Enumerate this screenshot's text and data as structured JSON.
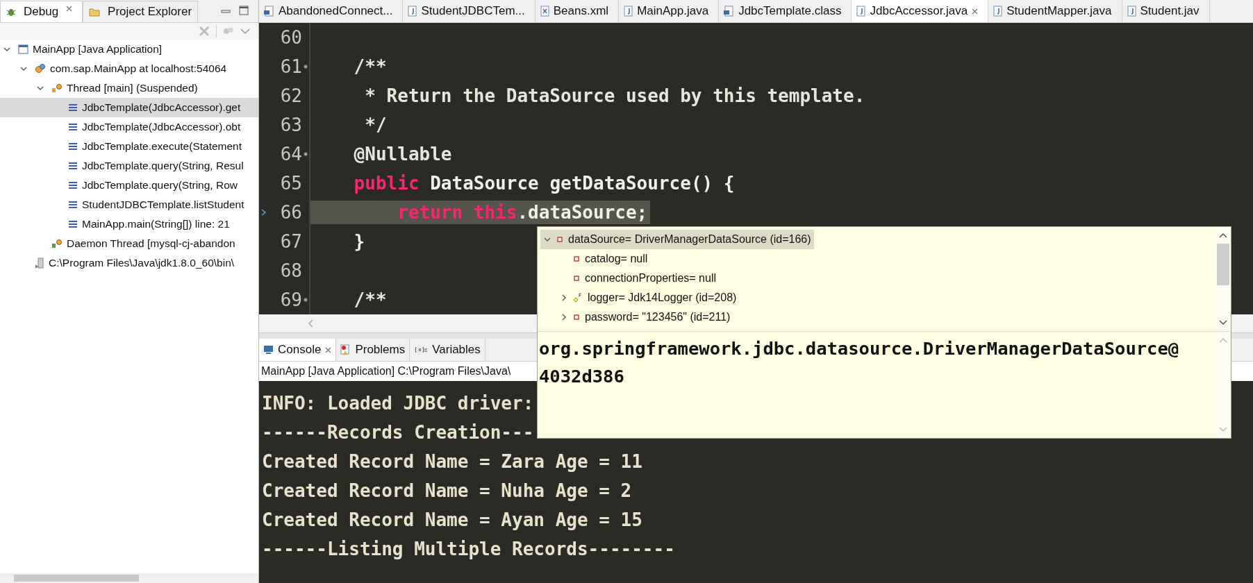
{
  "debug_panel": {
    "tabs": [
      {
        "label": "Debug",
        "selected": true,
        "kind": "bug"
      },
      {
        "label": "Project Explorer",
        "selected": false,
        "kind": "folder"
      }
    ],
    "tree": [
      {
        "label": "MainApp [Java Application]",
        "kind": "launch",
        "expanded": true,
        "selected": false,
        "children": [
          {
            "label": "com.sap.MainApp at localhost:54064",
            "kind": "target",
            "expanded": true,
            "selected": false,
            "children": [
              {
                "label": "Thread [main] (Suspended)",
                "kind": "thread",
                "expanded": true,
                "selected": false,
                "children": [
                  {
                    "label": "JdbcTemplate(JdbcAccessor).get",
                    "kind": "frame",
                    "selected": true
                  },
                  {
                    "label": "JdbcTemplate(JdbcAccessor).obt",
                    "kind": "frame",
                    "selected": false
                  },
                  {
                    "label": "JdbcTemplate.execute(Statement",
                    "kind": "frame",
                    "selected": false
                  },
                  {
                    "label": "JdbcTemplate.query(String, Resul",
                    "kind": "frame",
                    "selected": false
                  },
                  {
                    "label": "JdbcTemplate.query(String, Row",
                    "kind": "frame",
                    "selected": false
                  },
                  {
                    "label": "StudentJDBCTemplate.listStudent",
                    "kind": "frame",
                    "selected": false
                  },
                  {
                    "label": "MainApp.main(String[]) line: 21",
                    "kind": "frame",
                    "selected": false
                  }
                ]
              },
              {
                "label": "Daemon Thread [mysql-cj-abandon",
                "kind": "daemon",
                "selected": false
              }
            ]
          },
          {
            "label": "C:\\Program Files\\Java\\jdk1.8.0_60\\bin\\",
            "kind": "process",
            "selected": false
          }
        ]
      }
    ]
  },
  "editor_tabs": [
    {
      "label": "AbandonedConnect...",
      "kind": "class",
      "selected": false
    },
    {
      "label": "StudentJDBCTem...",
      "kind": "java",
      "selected": false
    },
    {
      "label": "Beans.xml",
      "kind": "xml",
      "selected": false
    },
    {
      "label": "MainApp.java",
      "kind": "java",
      "selected": false
    },
    {
      "label": "JdbcTemplate.class",
      "kind": "class",
      "selected": false
    },
    {
      "label": "JdbcAccessor.java",
      "kind": "java",
      "selected": true
    },
    {
      "label": "StudentMapper.java",
      "kind": "java",
      "selected": false
    },
    {
      "label": "Student.jav",
      "kind": "java",
      "selected": false
    }
  ],
  "editor": {
    "lines": [
      {
        "number": "60",
        "foldable": false,
        "current": false
      },
      {
        "number": "61",
        "foldable": true,
        "current": false,
        "tokens": [
          {
            "text": "    /**",
            "kind": "comment"
          }
        ]
      },
      {
        "number": "62",
        "foldable": false,
        "current": false,
        "tokens": [
          {
            "text": "     * Return the DataSource used by this template.",
            "kind": "comment"
          }
        ]
      },
      {
        "number": "63",
        "foldable": false,
        "current": false,
        "tokens": [
          {
            "text": "     */",
            "kind": "comment"
          }
        ]
      },
      {
        "number": "64",
        "foldable": true,
        "current": false,
        "tokens": [
          {
            "text": "    @Nullable",
            "kind": "annotation"
          }
        ]
      },
      {
        "number": "65",
        "foldable": false,
        "current": false,
        "tokens": [
          {
            "text": "    public",
            "kind": "keyword"
          },
          {
            "text": " DataSource getDataSource() {",
            "kind": "plain"
          }
        ]
      },
      {
        "number": "66",
        "foldable": false,
        "current": true,
        "tokens": [
          {
            "text": "        return",
            "kind": "keyword"
          },
          {
            "text": " this",
            "kind": "keyword"
          },
          {
            "text": ".dataSource;",
            "kind": "plain"
          }
        ]
      },
      {
        "number": "67",
        "foldable": false,
        "current": false,
        "tokens": [
          {
            "text": "    }",
            "kind": "plain"
          }
        ]
      },
      {
        "number": "68",
        "foldable": false,
        "current": false
      },
      {
        "number": "69",
        "foldable": true,
        "current": false,
        "tokens": [
          {
            "text": "    /**",
            "kind": "comment"
          }
        ]
      }
    ]
  },
  "hover": {
    "tree": [
      {
        "label": "dataSource= DriverManagerDataSource  (id=166)",
        "kind": "private",
        "expanded": true,
        "selected": true
      },
      {
        "label": "catalog= null",
        "kind": "private",
        "selected": false
      },
      {
        "label": "connectionProperties= null",
        "kind": "private",
        "selected": false
      },
      {
        "label": "logger= Jdk14Logger  (id=208)",
        "kind": "static",
        "expanded": false,
        "selected": false
      },
      {
        "label": "password= \"123456\" (id=211)",
        "kind": "private",
        "expanded": false,
        "selected": false
      }
    ],
    "detail": [
      "org.springframework.jdbc.datasource.DriverManagerDataSource@",
      "4032d386"
    ]
  },
  "bottom_panel": {
    "tabs": [
      {
        "label": "Console",
        "selected": true,
        "kind": "console"
      },
      {
        "label": "Problems",
        "selected": false,
        "kind": "problems"
      },
      {
        "label": "Variables",
        "selected": false,
        "kind": "variables"
      }
    ],
    "console_title": "MainApp [Java Application] C:\\Program Files\\Java\\",
    "output": [
      "INFO: Loaded JDBC driver:",
      "------Records Creation---",
      "Created Record Name = Zara Age = 11",
      "Created Record Name = Nuha Age = 2",
      "Created Record Name = Ayan Age = 15",
      "------Listing Multiple Records--------"
    ]
  }
}
